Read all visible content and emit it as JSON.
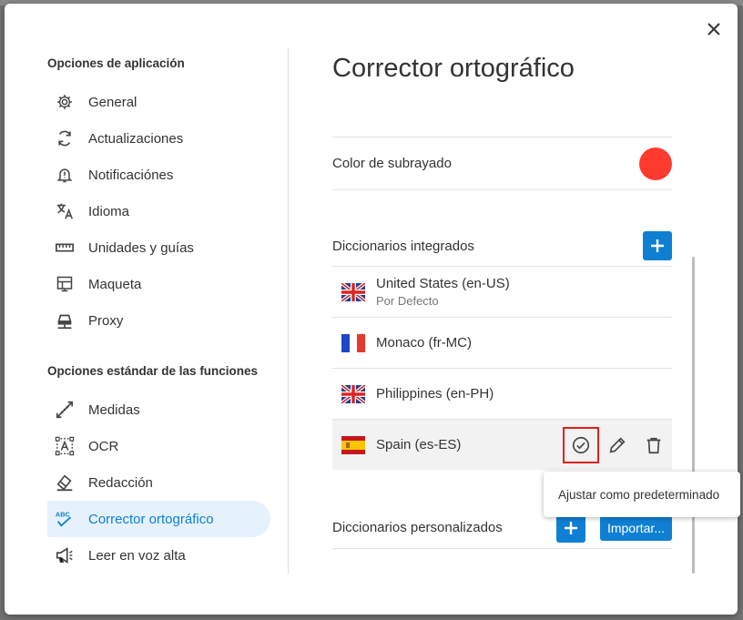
{
  "dialog": {
    "close_label": "×",
    "sidebar": {
      "section1_title": "Opciones de aplicación",
      "section1_items": [
        {
          "label": "General",
          "icon": "gear-icon"
        },
        {
          "label": "Actualizaciones",
          "icon": "refresh-icon"
        },
        {
          "label": "Notificaciónes",
          "icon": "bell-alert-icon"
        },
        {
          "label": "Idioma",
          "icon": "translate-icon"
        },
        {
          "label": "Unidades y guías",
          "icon": "ruler-icon"
        },
        {
          "label": "Maqueta",
          "icon": "layout-icon"
        },
        {
          "label": "Proxy",
          "icon": "network-icon"
        }
      ],
      "section2_title": "Opciones estándar de las funciones",
      "section2_items": [
        {
          "label": "Medidas",
          "icon": "measure-icon"
        },
        {
          "label": "OCR",
          "icon": "ocr-icon"
        },
        {
          "label": "Redacción",
          "icon": "eraser-icon"
        },
        {
          "label": "Corrector ortográfico",
          "icon": "spellcheck-icon",
          "active": true
        },
        {
          "label": "Leer en voz alta",
          "icon": "megaphone-icon"
        }
      ]
    },
    "main": {
      "title": "Corrector ortográfico",
      "underline_color_label": "Color de subrayado",
      "underline_color": "#ff3b30",
      "builtin_title": "Diccionarios integrados",
      "builtin": [
        {
          "name": "United States (en-US)",
          "sub": "Por Defecto",
          "flag": "uk"
        },
        {
          "name": "Monaco (fr-MC)",
          "sub": "",
          "flag": "fr"
        },
        {
          "name": "Philippines (en-PH)",
          "sub": "",
          "flag": "uk"
        },
        {
          "name": "Spain (es-ES)",
          "sub": "",
          "flag": "es"
        }
      ],
      "custom_title": "Diccionarios personalizados",
      "import_label": "Importar...",
      "tooltip": "Ajustar como predeterminado"
    },
    "colors": {
      "accent": "#0f7fd3",
      "highlight_border": "#e0201b"
    }
  }
}
